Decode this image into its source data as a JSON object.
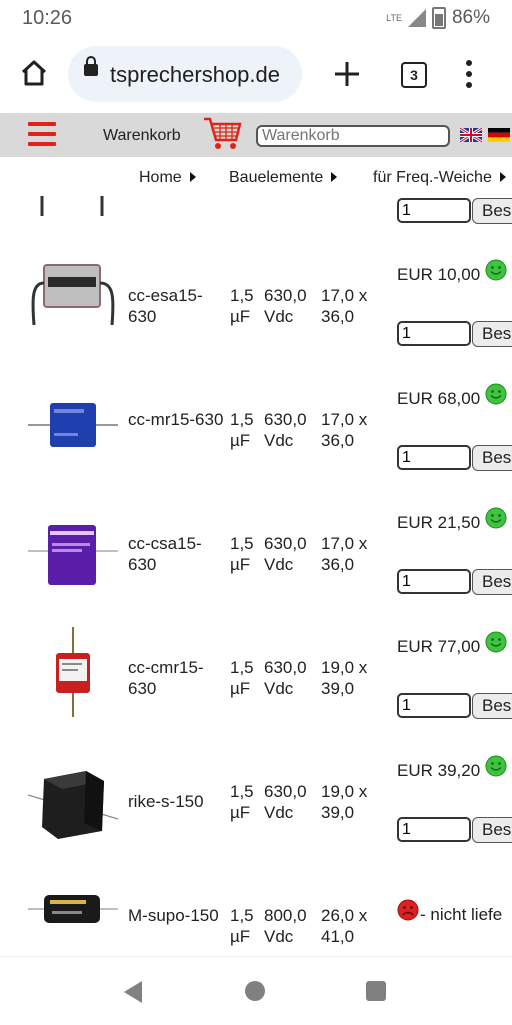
{
  "status": {
    "time": "10:26",
    "network": "LTE",
    "battery": "86%"
  },
  "browser": {
    "url": "tsprechershop.de",
    "tab_count": "3"
  },
  "header": {
    "cart_label": "Warenkorb",
    "search_placeholder": "Warenkorb"
  },
  "breadcrumb": [
    {
      "label": "Home"
    },
    {
      "label": "Bauelemente"
    },
    {
      "label": "für Freq.-Weiche"
    }
  ],
  "buy_label": "Bes",
  "top_partial": {
    "qty": "1"
  },
  "products": [
    {
      "name": "cc-esa15-630",
      "spec1": "1,5 µF",
      "spec2": "630,0 Vdc",
      "dim": "17,0 x 36,0",
      "price": "EUR 10,00",
      "status": "green",
      "qty": "1",
      "color": "#c0c0c0"
    },
    {
      "name": "cc-mr15-630",
      "spec1": "1,5 µF",
      "spec2": "630,0 Vdc",
      "dim": "17,0 x 36,0",
      "price": "EUR 68,00",
      "status": "green",
      "qty": "1",
      "color": "#1f3fae"
    },
    {
      "name": "cc-csa15-630",
      "spec1": "1,5 µF",
      "spec2": "630,0 Vdc",
      "dim": "17,0 x 36,0",
      "price": "EUR 21,50",
      "status": "green",
      "qty": "1",
      "color": "#5a1ea8"
    },
    {
      "name": "cc-cmr15-630",
      "spec1": "1,5 µF",
      "spec2": "630,0 Vdc",
      "dim": "19,0 x 39,0",
      "price": "EUR 77,00",
      "status": "green",
      "qty": "1",
      "color": "#c8201e"
    },
    {
      "name": "rike-s-150",
      "spec1": "1,5 µF",
      "spec2": "630,0 Vdc",
      "dim": "19,0 x 39,0",
      "price": "EUR 39,20",
      "status": "green",
      "qty": "1",
      "color": "#2a2a2a"
    },
    {
      "name": "M-supo-150",
      "spec1": "1,5 µF",
      "spec2": "800,0 Vdc",
      "dim": "26,0 x 41,0",
      "unavailable": "- nicht liefe",
      "status": "red",
      "color": "#1a1a1a"
    }
  ],
  "colors": {
    "accent_red": "#e1221a",
    "header_bg": "#d9d9d9",
    "smiley_green": "#3ec43e",
    "smiley_red": "#e02020"
  }
}
